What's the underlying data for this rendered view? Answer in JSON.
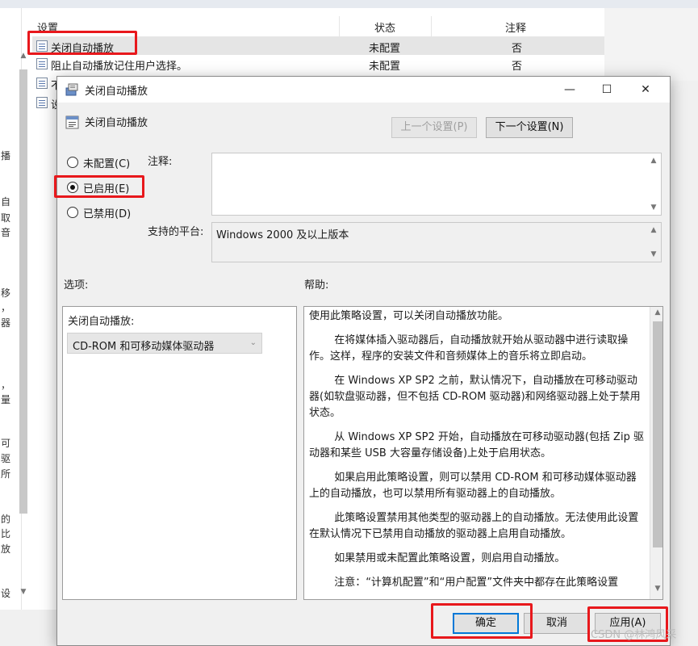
{
  "background": {
    "headers": {
      "setting": "设置",
      "state": "状态",
      "comment": "注释"
    },
    "rows": [
      {
        "name": "关闭自动播放",
        "state": "未配置",
        "comment": "否",
        "selected": true
      },
      {
        "name": "阻止自动播放记住用户选择。",
        "state": "未配置",
        "comment": "否",
        "selected": false
      },
      {
        "name": "不",
        "state": "",
        "comment": ""
      },
      {
        "name": "设",
        "state": "",
        "comment": ""
      }
    ],
    "left_fragments": [
      "播",
      "自",
      "取",
      "音",
      "移",
      "，",
      "器",
      "，",
      "量",
      "可",
      "驱",
      "所",
      "的",
      "比",
      "放",
      "设"
    ]
  },
  "dialog": {
    "title": "关闭自动播放",
    "window_controls": {
      "minimize": "—",
      "maximize": "☐",
      "close": "✕"
    },
    "policy_name": "关闭自动播放",
    "prev_button": "上一个设置(P)",
    "next_button": "下一个设置(N)",
    "radios": [
      {
        "label": "未配置(C)",
        "checked": false
      },
      {
        "label": "已启用(E)",
        "checked": true
      },
      {
        "label": "已禁用(D)",
        "checked": false
      }
    ],
    "comment_label": "注释:",
    "comment_value": "",
    "platform_label": "支持的平台:",
    "platform_value": "Windows 2000 及以上版本",
    "options_label": "选项:",
    "help_label": "帮助:",
    "options": {
      "autoplay_label": "关闭自动播放:",
      "autoplay_value": "CD-ROM 和可移动媒体驱动器"
    },
    "help_paragraphs": [
      "使用此策略设置，可以关闭自动播放功能。",
      "在将媒体插入驱动器后，自动播放就开始从驱动器中进行读取操作。这样，程序的安装文件和音频媒体上的音乐将立即启动。",
      "在 Windows XP SP2 之前，默认情况下，自动播放在可移动驱动器(如软盘驱动器，但不包括 CD-ROM 驱动器)和网络驱动器上处于禁用状态。",
      "从 Windows XP SP2 开始，自动播放在可移动驱动器(包括 Zip 驱动器和某些 USB 大容量存储设备)上处于启用状态。",
      "如果启用此策略设置，则可以禁用 CD-ROM 和可移动媒体驱动器上的自动播放，也可以禁用所有驱动器上的自动播放。",
      "此策略设置禁用其他类型的驱动器上的自动播放。无法使用此设置在默认情况下已禁用自动播放的驱动器上启用自动播放。",
      "如果禁用或未配置此策略设置，则启用自动播放。",
      "注意：“计算机配置”和“用户配置”文件夹中都存在此策略设置"
    ],
    "buttons": {
      "ok": "确定",
      "cancel": "取消",
      "apply": "应用(A)"
    }
  },
  "watermark": "CSDN @林鸿风采"
}
